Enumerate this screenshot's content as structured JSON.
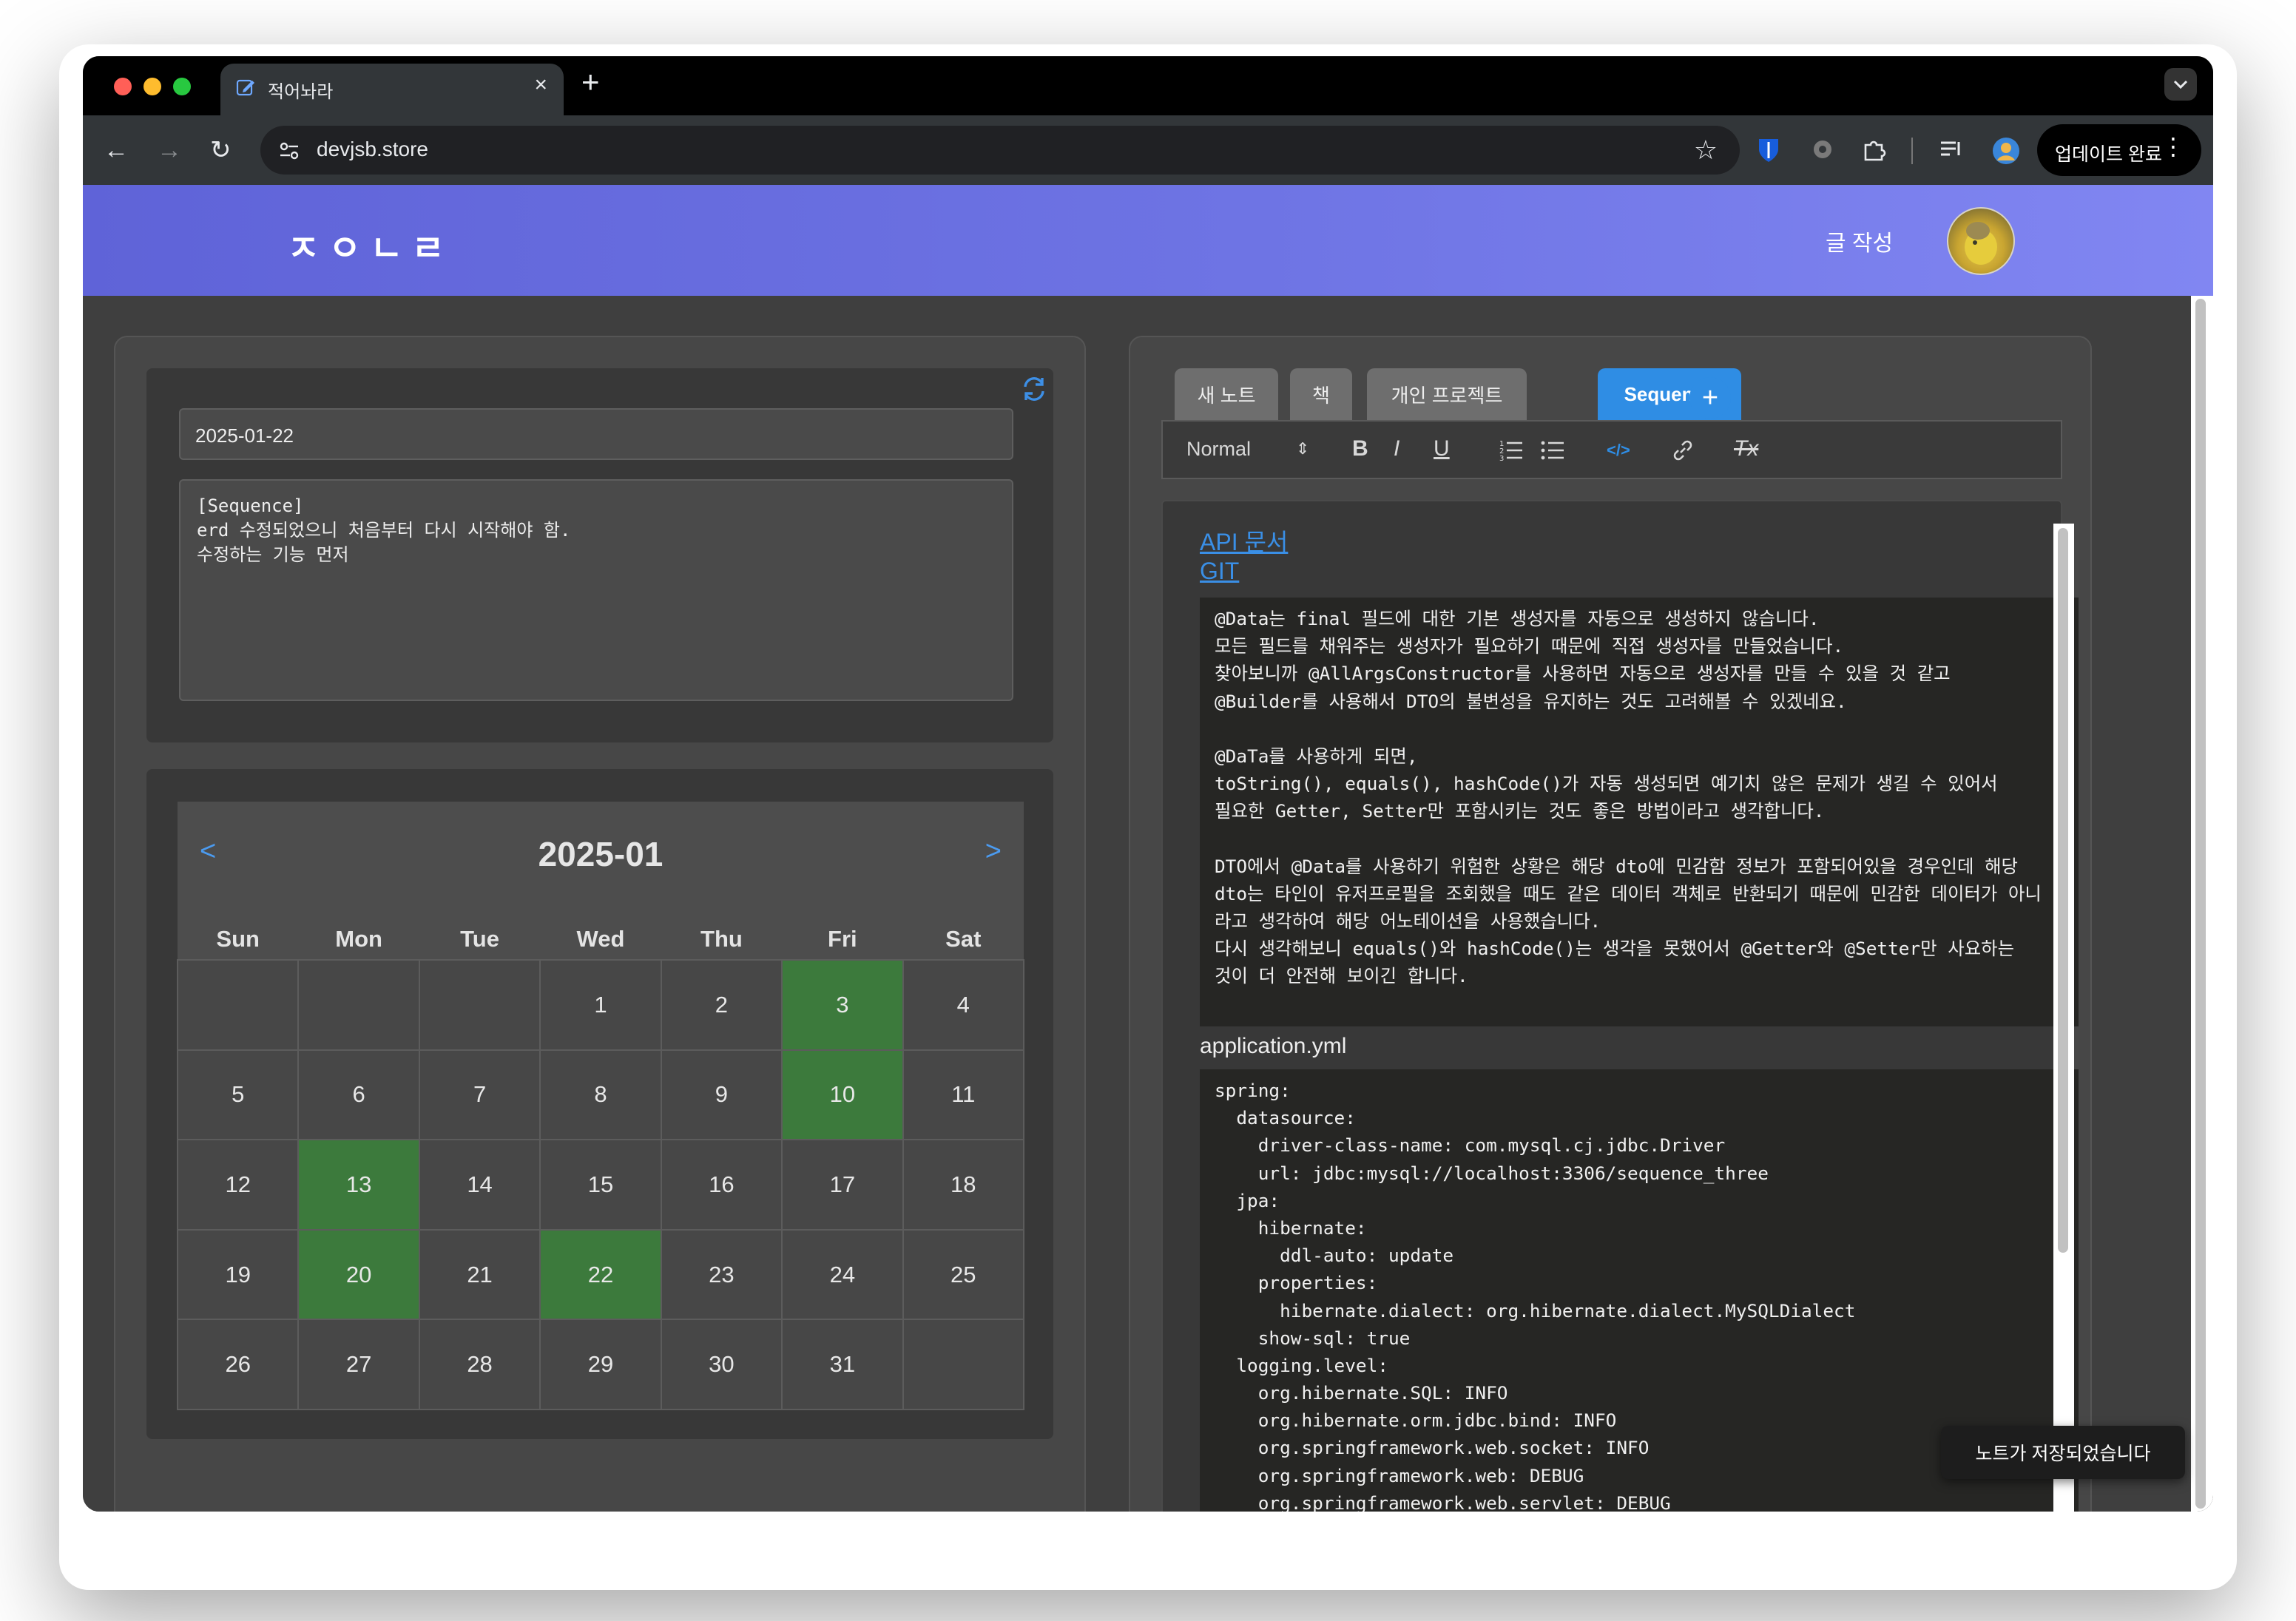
{
  "browser": {
    "tab_title": "적어놔라",
    "url": "devjsb.store",
    "update_button": "업데이트 완료"
  },
  "site": {
    "logo": "ㅈㅇㄴㄹ",
    "write_link": "글 작성"
  },
  "memo": {
    "date": "2025-01-22",
    "text": "[Sequence]\nerd 수정되었으니 처음부터 다시 시작해야 함.\n수정하는 기능 먼저"
  },
  "calendar": {
    "prev": "<",
    "next": ">",
    "month": "2025-01",
    "weekdays": [
      "Sun",
      "Mon",
      "Tue",
      "Wed",
      "Thu",
      "Fri",
      "Sat"
    ],
    "cells": [
      "",
      "",
      "",
      "1",
      "2",
      "3",
      "4",
      "5",
      "6",
      "7",
      "8",
      "9",
      "10",
      "11",
      "12",
      "13",
      "14",
      "15",
      "16",
      "17",
      "18",
      "19",
      "20",
      "21",
      "22",
      "23",
      "24",
      "25",
      "26",
      "27",
      "28",
      "29",
      "30",
      "31",
      ""
    ],
    "highlighted_days": [
      "3",
      "10",
      "13",
      "20",
      "22"
    ],
    "highlight_color": "#3c7a3c"
  },
  "notes": {
    "tabs": [
      "새 노트",
      "책",
      "개인 프로젝트",
      "Sequence"
    ],
    "active_tab": "Sequence",
    "add_tab": "+",
    "toolbar": {
      "heading_select": "Normal",
      "bold": "B",
      "italic": "I",
      "underline": "U",
      "code": "</>",
      "clear_format": "Tx"
    },
    "links": [
      "API 문서",
      "GIT"
    ],
    "code_block_1": [
      "@Data는 final 필드에 대한 기본 생성자를 자동으로 생성하지 않습니다.",
      "모든 필드를 채워주는 생성자가 필요하기 때문에 직접 생성자를 만들었습니다.",
      "찾아보니까 @AllArgsConstructor를 사용하면 자동으로 생성자를 만들 수 있을 것 같고",
      "@Builder를 사용해서 DTO의 불변성을 유지하는 것도 고려해볼 수 있겠네요.",
      "",
      "@DaTa를 사용하게 되면,",
      "toString(), equals(), hashCode()가 자동 생성되면 예기치 않은 문제가 생길 수 있어서",
      "필요한 Getter, Setter만 포함시키는 것도 좋은 방법이라고 생각합니다.",
      "",
      "DTO에서 @Data를 사용하기 위험한 상황은 해당 dto에 민감함 정보가 포함되어있을 경우인데 해당",
      "dto는 타인이 유저프로필을 조회했을 때도 같은 데이터 객체로 반환되기 때문에 민감한 데이터가 아니",
      "라고 생각하여 해당 어노테이션을 사용했습니다.",
      "다시 생각해보니 equals()와 hashCode()는 생각을 못했어서 @Getter와 @Setter만 사요하는",
      "것이 더 안전해 보이긴 합니다."
    ],
    "yml_label": "application.yml",
    "code_block_2": [
      "spring:",
      "  datasource:",
      "    driver-class-name: com.mysql.cj.jdbc.Driver",
      "    url: jdbc:mysql://localhost:3306/sequence_three",
      "  jpa:",
      "    hibernate:",
      "      ddl-auto: update",
      "    properties:",
      "      hibernate.dialect: org.hibernate.dialect.MySQLDialect",
      "    show-sql: true",
      "  logging.level:",
      "    org.hibernate.SQL: INFO",
      "    org.hibernate.orm.jdbc.bind: INFO",
      "    org.springframework.web.socket: INFO",
      "    org.springframework.web: DEBUG",
      "    org.springframework.web.servlet: DEBUG"
    ]
  },
  "toast": "노트가 저장되었습니다",
  "colors": {
    "header_gradient_start": "#5f63d8",
    "header_gradient_end": "#8186f2",
    "accent_blue": "#2f8de4"
  }
}
